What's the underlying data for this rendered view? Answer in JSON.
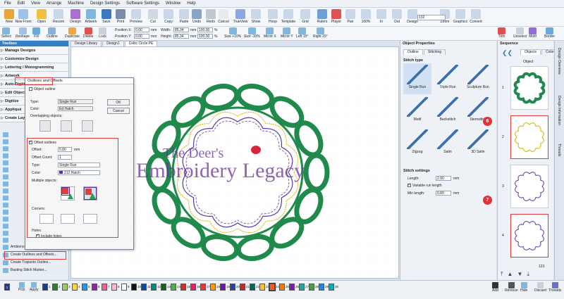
{
  "menu": [
    "File",
    "Edit",
    "View",
    "Arrange",
    "Machine",
    "Design Settings",
    "Software Settings",
    "Window",
    "Help"
  ],
  "toolbar": {
    "row1": [
      "New",
      "New From",
      "Open",
      "Recent",
      "Design",
      "Artwork",
      "Save",
      "Print",
      "Preview",
      "Cut",
      "Copy",
      "Paste",
      "Undo",
      "Redo",
      "Cancel",
      "TrueView",
      "Show",
      "Hoop",
      "Template",
      "Grid",
      "Rulers",
      "Player",
      "Pan",
      "100%",
      "In",
      "Out",
      "Design",
      "Zoom",
      "Graphics",
      "Convert"
    ],
    "zoom_value": "132",
    "row2": [
      "Select",
      "Reshape",
      "Fill",
      "Outline",
      "Duplicate",
      "Delete",
      "Lock"
    ],
    "position_x_label": "Position X:",
    "position_x": "0.00",
    "position_y_label": "Position Y:",
    "position_y": "0.00",
    "width_label": "Width:",
    "width": "85.34",
    "height_label": "Height:",
    "height": "85.34",
    "mm": "mm",
    "pct1": "100.00",
    "pct2": "100.00",
    "pct_sign": "%",
    "transform": [
      "Size +10%",
      "Size -10%",
      "Mirror X",
      "Mirror Y",
      "Left 15°",
      "Right 15°"
    ],
    "right_tools": [
      "Trim",
      "Unselect",
      "Motif",
      "Border"
    ]
  },
  "tabs": [
    "Design Library",
    "Design1",
    "Celtic Circle PE"
  ],
  "toolbox": {
    "title": "Toolbox",
    "sections": [
      "Manage Designs",
      "Customize Design",
      "Lettering / Monogramming",
      "Artwork",
      "Auto-Digitize",
      "Edit Objects",
      "Digitize",
      "Appliqué",
      "Create Layouts"
    ],
    "tools_bottom": [
      "Ambience Quilting...",
      "Create Outlines and Offsets...",
      "Create Trapunto Outline...",
      "Basting Stitch Marker..."
    ]
  },
  "dialog": {
    "title": "Outlines and Offsets",
    "object_outline": "Object outline",
    "type_label": "Type:",
    "type_value": "Single Run",
    "color_label": "Color:",
    "color_value": "Ed Hatch",
    "overlapping": "Overlapping objects:",
    "ok": "OK",
    "cancel": "Cancel",
    "offset_outlines": "Offset outlines",
    "offset_label": "Offset:",
    "offset_value": "5.00",
    "offset_unit": "mm",
    "offset_count_label": "Offset Count:",
    "offset_count": "1",
    "type2_label": "Type:",
    "type2_value": "Single Run",
    "color2_label": "Color:",
    "color2_value": "212 Hatch",
    "multiple": "Multiple objects:",
    "corners": "Corners:",
    "holes": "Holes:",
    "include_holes": "Include holes"
  },
  "watermark": {
    "line1": "The Deer's",
    "line2": "Embroidery Legacy"
  },
  "object_properties": {
    "title": "Object Properties",
    "tabs": [
      "Outline",
      "Stitching"
    ],
    "stitch_type": "Stitch type",
    "stitches": [
      "Single Run",
      "Triple Run",
      "Sculpture Run",
      "Motif",
      "Backstitch",
      "Stemstitch",
      "Zigzag",
      "Satin",
      "3D Satin"
    ],
    "settings_title": "Stitch settings",
    "length_label": "Length:",
    "length_value": "2.00",
    "variable": "Variable run length",
    "min_length_label": "Min length:",
    "min_length_value": "0.80",
    "mm": "mm"
  },
  "sequence": {
    "title": "Sequence",
    "tabs": [
      "Objects",
      "Colors"
    ],
    "header": "Object",
    "rows": [
      "1",
      "2",
      "3",
      "4"
    ],
    "callouts": [
      "6",
      "7"
    ],
    "count": "123"
  },
  "side_tabs": [
    "Design Overview",
    "Design Information",
    "Threads"
  ],
  "bottom": {
    "buttons_left": [
      "Pick",
      "Apply"
    ],
    "colors": [
      {
        "n": "1",
        "c": "#1e3a8a"
      },
      {
        "n": "2",
        "c": "#2e7d32"
      },
      {
        "n": "3",
        "c": "#9ccc65"
      },
      {
        "n": "4",
        "c": "#fdd835"
      },
      {
        "n": "5",
        "c": "#2196f3"
      },
      {
        "n": "6",
        "c": "#8e24aa"
      },
      {
        "n": "7",
        "c": "#f06292"
      },
      {
        "n": "8",
        "c": "#f8bbd0"
      },
      {
        "n": "9",
        "c": "#ffffff"
      },
      {
        "n": "10",
        "c": "#111111"
      },
      {
        "n": "11",
        "c": "#0d47a1"
      },
      {
        "n": "12",
        "c": "#00897b"
      },
      {
        "n": "13",
        "c": "#1b5e20"
      },
      {
        "n": "14",
        "c": "#4caf50"
      },
      {
        "n": "15",
        "c": "#d32f2f"
      },
      {
        "n": "16",
        "c": "#e91e63"
      },
      {
        "n": "17",
        "c": "#e53935"
      },
      {
        "n": "18",
        "c": "#ff9800"
      },
      {
        "n": "19",
        "c": "#6a1b9a"
      },
      {
        "n": "20",
        "c": "#303f9f"
      },
      {
        "n": "21",
        "c": "#c62828"
      },
      {
        "n": "22",
        "c": "#00695c"
      },
      {
        "n": "23",
        "c": "#fbc02d"
      },
      {
        "n": "24",
        "c": "#ff5722"
      },
      {
        "n": "25",
        "c": "#f57c00"
      },
      {
        "n": "26",
        "c": "#7b1fa2"
      },
      {
        "n": "27",
        "c": "#26a69a"
      },
      {
        "n": "28",
        "c": "#43a047"
      },
      {
        "n": "29",
        "c": "#1e88e5"
      },
      {
        "n": "30",
        "c": "#00acc1"
      }
    ],
    "buttons_right": [
      "Add",
      "Remove",
      "Hide",
      "Discard",
      "Threads"
    ]
  },
  "colors": {
    "accent": "#2f7fc9",
    "highlight": "#e23b3b",
    "green": "#1f8a4c",
    "purple": "#6b2fa0"
  }
}
